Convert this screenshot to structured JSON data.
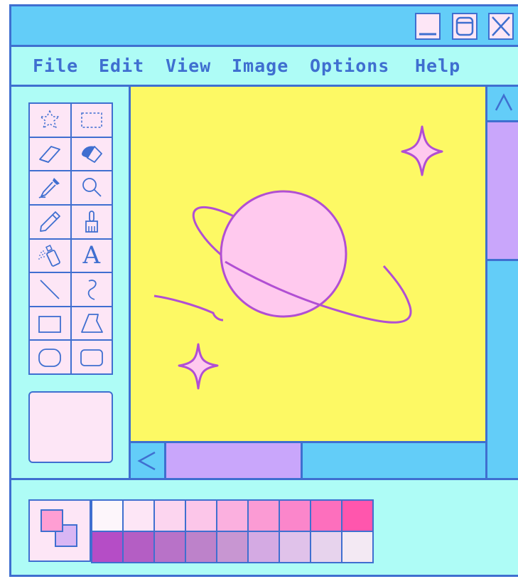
{
  "window": {
    "buttons": [
      {
        "name": "minimize",
        "icon": "minimize-icon"
      },
      {
        "name": "maximize",
        "icon": "maximize-icon"
      },
      {
        "name": "close",
        "icon": "close-icon"
      }
    ]
  },
  "menu": {
    "items": [
      "File",
      "Edit",
      "View",
      "Image",
      "Options",
      "Help"
    ]
  },
  "tools": [
    "free-select-icon",
    "rect-select-icon",
    "eraser-icon",
    "fill-bucket-icon",
    "eyedropper-icon",
    "magnifier-icon",
    "pencil-icon",
    "brush-icon",
    "airbrush-icon",
    "text-icon",
    "line-icon",
    "curve-icon",
    "rectangle-icon",
    "polygon-icon",
    "ellipse-icon",
    "rounded-rect-icon"
  ],
  "tool_text_label": "A",
  "scroll": {
    "up_icon": "chevron-up-icon",
    "left_icon": "chevron-left-icon"
  },
  "colors": {
    "foreground": "#ff9ed3",
    "background": "#d9b6f4",
    "palette_row1": [
      "#fdf6fb",
      "#fde6f6",
      "#fcd5ef",
      "#fcc6e9",
      "#fbb0df",
      "#fb9bd4",
      "#fb86cb",
      "#fd6fbd",
      "#ff56ad"
    ],
    "palette_row2": [
      "#b54dc6",
      "#b45ec4",
      "#b872c8",
      "#bd82ca",
      "#c896d2",
      "#d4aae3",
      "#e0c2ea",
      "#e7d3ed",
      "#f3e9f3"
    ]
  },
  "accent": "#3f6fd0"
}
